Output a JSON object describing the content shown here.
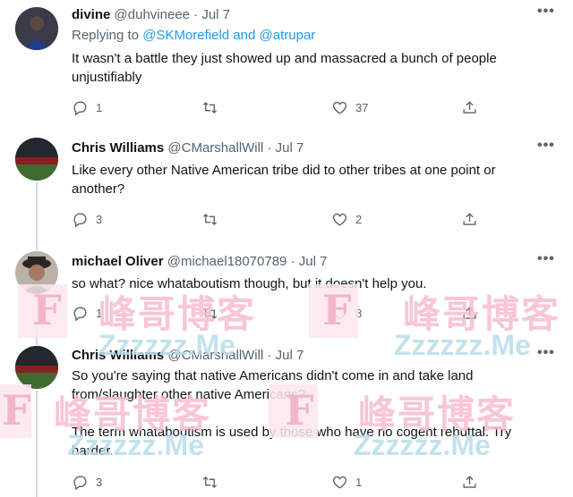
{
  "tweets": [
    {
      "name": "divine",
      "handle": "@duhvineee",
      "sep": "·",
      "date": "Jul 7",
      "reply_prefix": "Replying to",
      "reply_mention_1": "@SKMorefield",
      "reply_and": "and",
      "reply_mention_2": "@atrupar",
      "text": "It wasn't a battle they just showed up and massacred a bunch of people unjustifiably",
      "replies": "1",
      "retweets": "",
      "likes": "37"
    },
    {
      "name": "Chris Williams",
      "handle": "@CMarshallWill",
      "sep": "·",
      "date": "Jul 7",
      "text": "Like every other Native American tribe did to other tribes at one point or another?",
      "replies": "3",
      "retweets": "",
      "likes": "2"
    },
    {
      "name": "michael Oliver",
      "handle": "@michael18070789",
      "sep": "·",
      "date": "Jul 7",
      "text": "so what? nice whataboutism though, but it doesn't help you.",
      "replies": "1",
      "retweets": "",
      "likes": "8"
    },
    {
      "name": "Chris Williams",
      "handle": "@CMarshallWill",
      "sep": "·",
      "date": "Jul 7",
      "text": "So you're saying that native Americans didn't come in and take land from/slaughter other native Americans?\n\nThe term whataboutism is used by those who have no cogent rebuttal. Try harder.",
      "replies": "3",
      "retweets": "",
      "likes": "1"
    }
  ],
  "more_label": "•••",
  "watermark": {
    "f": "F",
    "cn": "峰哥博客",
    "site": "Zzzzzz.Me"
  },
  "colors": {
    "text": "#0f1419",
    "secondary": "#536471",
    "link": "#1d9bf0",
    "thread_line": "#cfd9de"
  },
  "icons": [
    "reply-icon",
    "retweet-icon",
    "like-icon",
    "share-icon",
    "more-icon"
  ]
}
